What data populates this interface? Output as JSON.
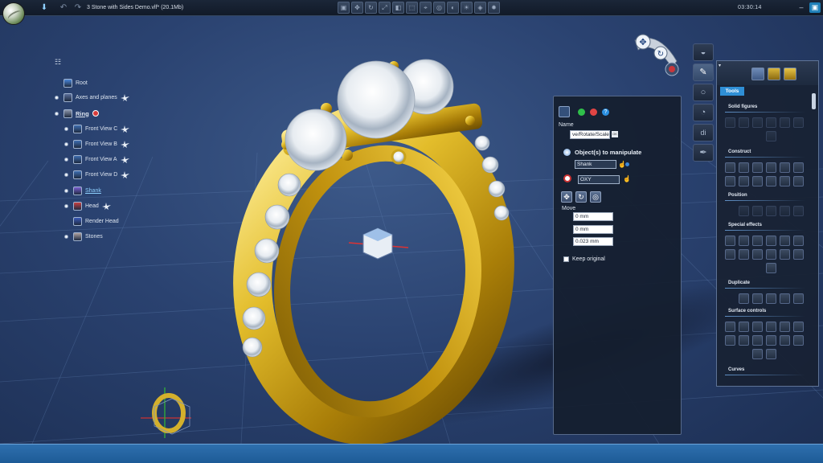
{
  "window": {
    "title": "3 Stone with Sides Demo.vlf* (20.1Mb)",
    "clock": "03:30:14"
  },
  "colors": {
    "background": "#2a4270",
    "panel": "#141e2e",
    "accent": "#2f8fd6",
    "gold": "#c9a21c"
  },
  "tree": {
    "menu_icon": "menu-icon",
    "items": [
      {
        "label": "Root",
        "icon": "globe-icon"
      },
      {
        "label": "Axes and planes",
        "icon": "axes-icon"
      },
      {
        "label": "Ring",
        "icon": "ring-icon"
      },
      {
        "label": "Front View C",
        "icon": "camera-icon"
      },
      {
        "label": "Front View B",
        "icon": "camera-icon"
      },
      {
        "label": "Front View A",
        "icon": "camera-icon"
      },
      {
        "label": "Front View D",
        "icon": "camera-icon"
      },
      {
        "label": "Shank",
        "icon": "shank-icon"
      },
      {
        "label": "Head",
        "icon": "head-icon"
      },
      {
        "label": "Render Head",
        "icon": "render-icon"
      },
      {
        "label": "Stones",
        "icon": "stones-icon"
      }
    ]
  },
  "manipulator": {
    "name_label": "Name",
    "name_value": "ve/Rotate/Scale",
    "name_badge": "OK",
    "objects_title": "Object(s) to manipulate",
    "object_value": "Shank",
    "plane_value": "OXY",
    "move_label": "Move",
    "move_values": [
      "0 mm",
      "0 mm",
      "0.023 mm"
    ],
    "keep_original_label": "Keep original",
    "keep_original": false
  },
  "tools": {
    "tab_label": "Tools",
    "sections": [
      "Solid figures",
      "Construct",
      "Position",
      "Special effects",
      "Duplicate",
      "Surface controls",
      "Curves"
    ]
  }
}
